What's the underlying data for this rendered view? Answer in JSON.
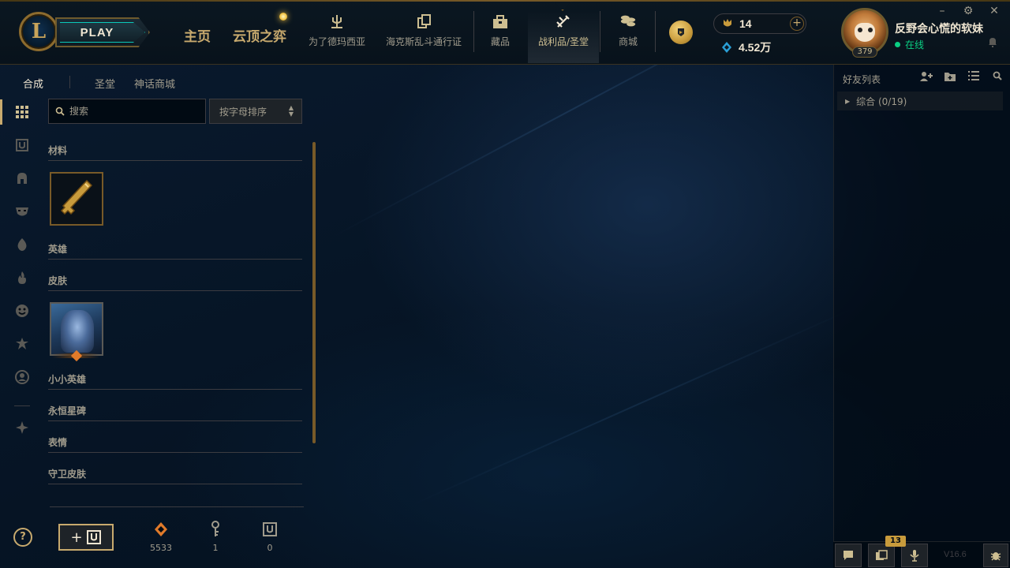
{
  "window": {
    "controls": [
      "–",
      "⚙",
      "✕"
    ]
  },
  "header": {
    "logo_letter": "L",
    "play_label": "PLAY",
    "main_tabs": [
      {
        "label": "主页"
      },
      {
        "label": "云顶之弈"
      }
    ],
    "nav_items": [
      {
        "label": "为了德玛西亚",
        "icon": "trident-icon"
      },
      {
        "label": "海克斯乱斗通行证",
        "icon": "cards-icon"
      },
      {
        "label": "藏品",
        "icon": "collection-icon"
      },
      {
        "label": "战利品/圣堂",
        "icon": "loot-icon",
        "active": true
      },
      {
        "label": "商城",
        "icon": "coins-icon"
      }
    ],
    "currency": {
      "gold": "14",
      "blue": "4.52万"
    },
    "profile": {
      "username": "反野会心慌的软妹",
      "status": "在线",
      "level": "379"
    }
  },
  "loot": {
    "subtabs": [
      {
        "label": "合成",
        "active": true
      },
      {
        "label": "圣堂"
      },
      {
        "label": "神话商城"
      }
    ],
    "search_placeholder": "搜索",
    "sort_label": "按字母排序",
    "sections": [
      {
        "title": "材料"
      },
      {
        "title": "英雄"
      },
      {
        "title": "皮肤"
      },
      {
        "title": "小小英雄"
      },
      {
        "title": "永恒星碑"
      },
      {
        "title": "表情"
      },
      {
        "title": "守卫皮肤"
      }
    ],
    "resources": [
      {
        "icon": "orange-essence-icon",
        "value": "5533"
      },
      {
        "icon": "key-icon",
        "value": "1"
      },
      {
        "icon": "chest-icon",
        "value": "0"
      }
    ],
    "help_label": "?"
  },
  "social": {
    "title": "好友列表",
    "group": "综合 (0/19)",
    "badge": "13",
    "version": "V16.6"
  },
  "colors": {
    "gold": "#c8aa6e",
    "gold_dark": "#785a28",
    "text": "#a09b8c",
    "bright": "#f0e6d2",
    "online": "#0acf83",
    "bg": "#010a13"
  }
}
